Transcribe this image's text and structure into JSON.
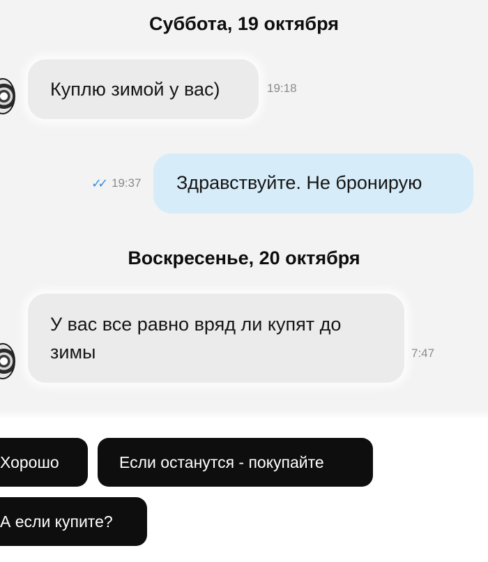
{
  "messages": {
    "date1": "Суббота, 19 октября",
    "m1": {
      "text": "Куплю зимой у вас)",
      "time": "19:18"
    },
    "m2": {
      "text": "Здравствуйте. Не бронирую",
      "time": "19:37",
      "status": "read"
    },
    "date2": "Воскресенье, 20 октября",
    "m3": {
      "line1": "У вас все равно вряд ли купят до",
      "line2": "зимы",
      "time": "7:47"
    }
  },
  "quick_replies": {
    "r1": "Хорошо",
    "r2": "Если останутся - покупайте",
    "r3": "А если купите?"
  },
  "icons": {
    "read_status": "double-check-icon",
    "avatar": "avatar-image"
  },
  "colors": {
    "incoming_bubble": "#ebebeb",
    "outgoing_bubble": "#d6ecf8",
    "chip_bg": "#0e0e0e",
    "check_color": "#3a8ee0"
  }
}
